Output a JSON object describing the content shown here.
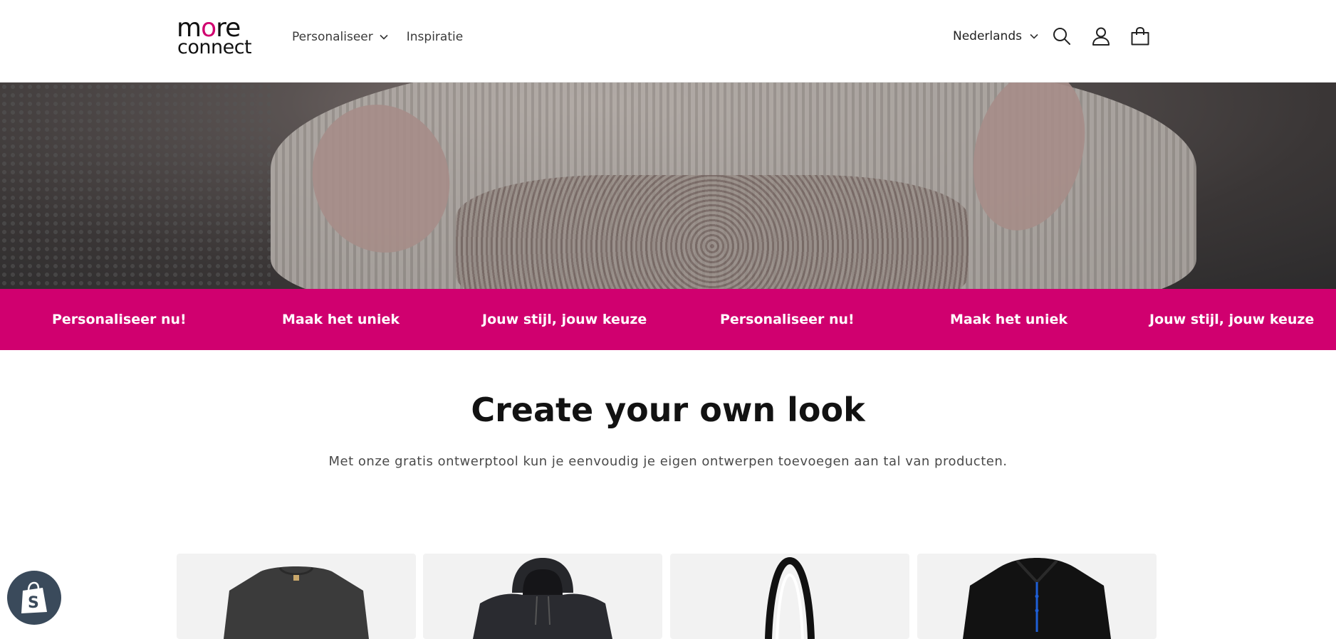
{
  "header": {
    "logo": {
      "line1_a": "m",
      "line1_o": "o",
      "line1_b": "re",
      "line2": "connect"
    },
    "nav": [
      {
        "label": "Personaliseer",
        "has_dropdown": true
      },
      {
        "label": "Inspiratie",
        "has_dropdown": false
      }
    ],
    "language": "Nederlands",
    "icons": [
      "search-icon",
      "account-icon",
      "cart-icon"
    ]
  },
  "marquee": {
    "items": [
      "Personaliseer nu!",
      "Maak het uniek",
      "Jouw stijl, jouw keuze",
      "Personaliseer nu!",
      "Maak het uniek",
      "Jouw stijl, jouw keuze"
    ],
    "color": "#d0006f"
  },
  "main": {
    "title": "Create your own look",
    "subtitle": "Met onze gratis ontwerptool kun je eenvoudig je eigen ontwerpen toevoegen aan tal van producten."
  },
  "products": [
    {
      "icon": "tshirt-icon"
    },
    {
      "icon": "hoodie-icon"
    },
    {
      "icon": "tote-bag-icon"
    },
    {
      "icon": "polo-icon"
    }
  ],
  "colors": {
    "accent": "#d0006f",
    "text": "#121212",
    "card_bg": "#f2f2f2"
  }
}
